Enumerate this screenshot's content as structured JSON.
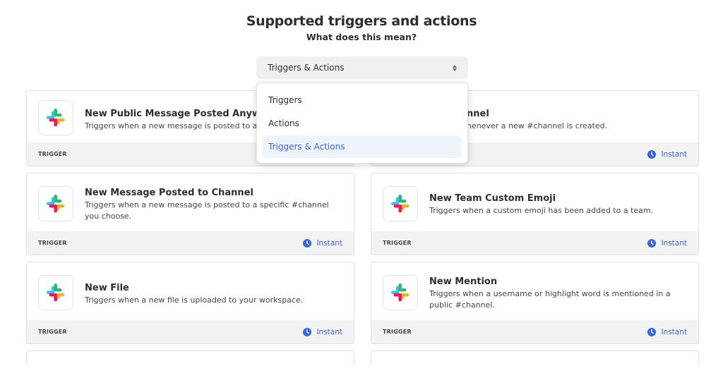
{
  "header": {
    "title": "Supported triggers and actions",
    "subtitle": "What does this mean?"
  },
  "filter": {
    "selected": "Triggers & Actions",
    "options": [
      "Triggers",
      "Actions",
      "Triggers & Actions"
    ]
  },
  "cards": [
    {
      "title": "New Public Message Posted Anywhere",
      "description": "Triggers when a new message is posted to any",
      "tag": "TRIGGER",
      "instant": ""
    },
    {
      "title": "nnel",
      "description": "henever a new #channel is created.",
      "tag": "",
      "instant": "Instant"
    },
    {
      "title": "New Message Posted to Channel",
      "description": "Triggers when a new message is posted to a specific #channel you choose.",
      "tag": "TRIGGER",
      "instant": "Instant"
    },
    {
      "title": "New Team Custom Emoji",
      "description": "Triggers when a custom emoji has been added to a team.",
      "tag": "TRIGGER",
      "instant": "Instant"
    },
    {
      "title": "New File",
      "description": "Triggers when a new file is uploaded to your workspace.",
      "tag": "TRIGGER",
      "instant": "Instant"
    },
    {
      "title": "New Mention",
      "description": "Triggers when a username or highlight word is mentioned in a public #channel.",
      "tag": "TRIGGER",
      "instant": "Instant"
    }
  ],
  "icons": {
    "app": "slack-logo-icon",
    "instant": "clock-icon",
    "select": "sort-arrows-icon"
  },
  "colors": {
    "accent": "#3b66d6",
    "footer_bg": "#f2f2f2",
    "slack_blue": "#36c5f0",
    "slack_green": "#2eb67d",
    "slack_yellow": "#ecb22e",
    "slack_red": "#e01e5a"
  }
}
